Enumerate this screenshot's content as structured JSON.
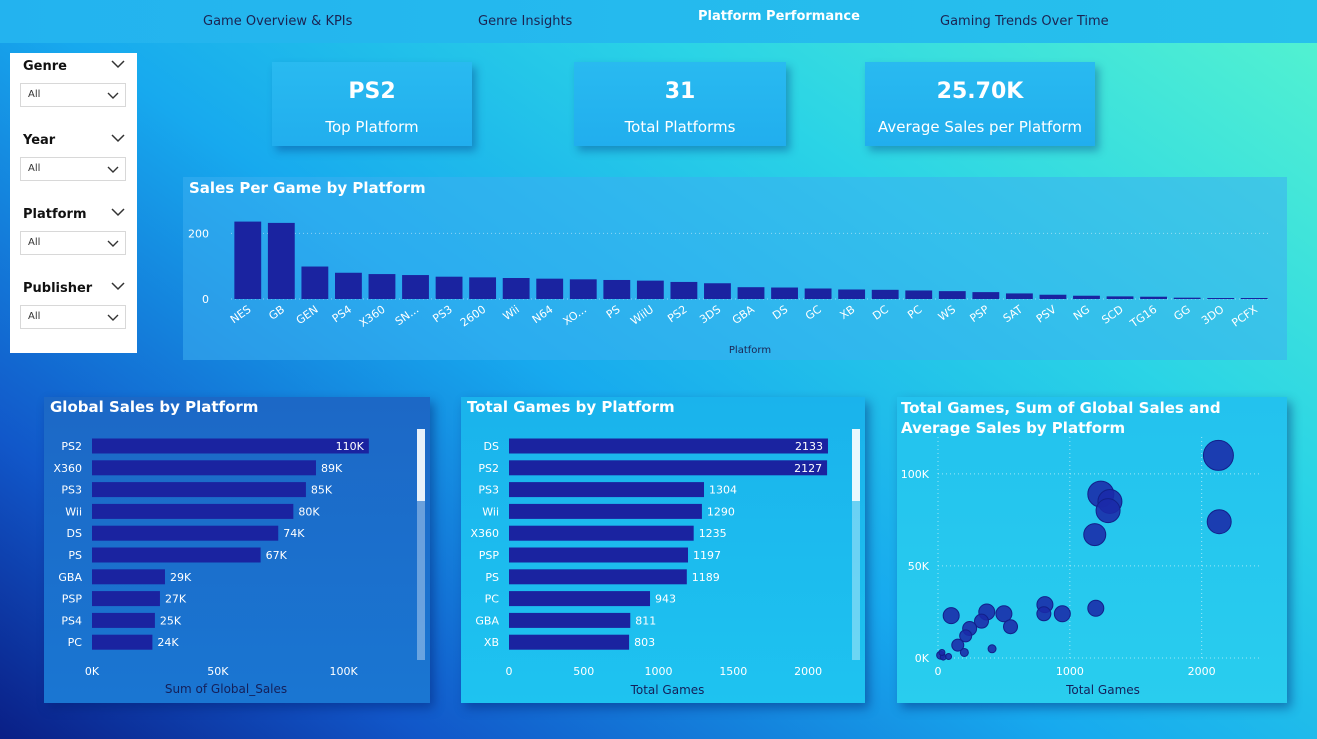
{
  "nav": {
    "tabs": [
      {
        "label": "Game Overview & KPIs"
      },
      {
        "label": "Genre Insights"
      },
      {
        "label": "Platform Performance"
      },
      {
        "label": "Gaming Trends Over Time"
      }
    ],
    "active": "Platform Performance"
  },
  "slicers": [
    {
      "title": "Genre",
      "value": "All"
    },
    {
      "title": "Year",
      "value": "All"
    },
    {
      "title": "Platform",
      "value": "All"
    },
    {
      "title": "Publisher",
      "value": "All"
    }
  ],
  "kpis": [
    {
      "value": "PS2",
      "label": "Top Platform"
    },
    {
      "value": "31",
      "label": "Total Platforms"
    },
    {
      "value": "25.70K",
      "label": "Average Sales per Platform"
    }
  ],
  "colors": {
    "bar": "#1a23a0",
    "bubble": "#1a2aa8"
  },
  "chart_data": [
    {
      "type": "bar",
      "title": "Sales Per Game by Platform",
      "xlabel": "Platform",
      "ylabel": "",
      "categories": [
        "NES",
        "GB",
        "GEN",
        "PS4",
        "X360",
        "SN...",
        "PS3",
        "2600",
        "Wii",
        "N64",
        "XO...",
        "PS",
        "WiiU",
        "PS2",
        "3DS",
        "GBA",
        "DS",
        "GC",
        "XB",
        "DC",
        "PC",
        "WS",
        "PSP",
        "SAT",
        "PSV",
        "NG",
        "SCD",
        "TG16",
        "GG",
        "3DO",
        "PCFX"
      ],
      "values": [
        236,
        232,
        99,
        80,
        76,
        73,
        68,
        66,
        64,
        62,
        60,
        58,
        56,
        52,
        48,
        36,
        35,
        32,
        29,
        28,
        26,
        24,
        21,
        17,
        13,
        10,
        8,
        7,
        4,
        2,
        1
      ],
      "yticks": [
        "0",
        "200"
      ],
      "ylim": [
        0,
        250
      ],
      "grid": true
    },
    {
      "type": "bar",
      "orientation": "horizontal",
      "title": "Global Sales by Platform",
      "xlabel": "Sum of Global_Sales",
      "categories": [
        "PS2",
        "X360",
        "PS3",
        "Wii",
        "DS",
        "PS",
        "GBA",
        "PSP",
        "PS4",
        "PC"
      ],
      "values": [
        110000,
        89000,
        85000,
        80000,
        74000,
        67000,
        29000,
        27000,
        25000,
        24000
      ],
      "labels": [
        "110K",
        "89K",
        "85K",
        "80K",
        "74K",
        "67K",
        "29K",
        "27K",
        "25K",
        "24K"
      ],
      "xticks": [
        "0K",
        "50K",
        "100K"
      ],
      "xlim": [
        0,
        120000
      ]
    },
    {
      "type": "bar",
      "orientation": "horizontal",
      "title": "Total Games by Platform",
      "xlabel": "Total Games",
      "categories": [
        "DS",
        "PS2",
        "PS3",
        "Wii",
        "X360",
        "PSP",
        "PS",
        "PC",
        "GBA",
        "XB"
      ],
      "values": [
        2133,
        2127,
        1304,
        1290,
        1235,
        1197,
        1189,
        943,
        811,
        803
      ],
      "labels": [
        "2133",
        "2127",
        "1304",
        "1290",
        "1235",
        "1197",
        "1189",
        "943",
        "811",
        "803"
      ],
      "xticks": [
        "0",
        "500",
        "1000",
        "1500",
        "2000"
      ],
      "xlim": [
        0,
        2200
      ]
    },
    {
      "type": "scatter",
      "title": "Total Games, Sum of Global Sales and Average Sales by Platform",
      "xlabel": "Total Games",
      "xticks": [
        "0",
        "1000",
        "2000"
      ],
      "yticks": [
        "0K",
        "50K",
        "100K"
      ],
      "xlim": [
        0,
        2450
      ],
      "ylim": [
        0,
        120000
      ],
      "points": [
        {
          "x": 2127,
          "y": 110000,
          "size": 15
        },
        {
          "x": 2133,
          "y": 74000,
          "size": 12
        },
        {
          "x": 1235,
          "y": 89000,
          "size": 13
        },
        {
          "x": 1304,
          "y": 85000,
          "size": 12
        },
        {
          "x": 1290,
          "y": 80000,
          "size": 12
        },
        {
          "x": 1189,
          "y": 67000,
          "size": 11
        },
        {
          "x": 1197,
          "y": 27000,
          "size": 8
        },
        {
          "x": 811,
          "y": 29000,
          "size": 8
        },
        {
          "x": 943,
          "y": 24000,
          "size": 8
        },
        {
          "x": 803,
          "y": 24000,
          "size": 7
        },
        {
          "x": 370,
          "y": 25000,
          "size": 8
        },
        {
          "x": 500,
          "y": 24000,
          "size": 8
        },
        {
          "x": 100,
          "y": 23000,
          "size": 8
        },
        {
          "x": 330,
          "y": 20000,
          "size": 7
        },
        {
          "x": 550,
          "y": 17000,
          "size": 7
        },
        {
          "x": 240,
          "y": 16000,
          "size": 7
        },
        {
          "x": 210,
          "y": 12000,
          "size": 6
        },
        {
          "x": 150,
          "y": 7000,
          "size": 6
        },
        {
          "x": 200,
          "y": 3000,
          "size": 4
        },
        {
          "x": 410,
          "y": 5000,
          "size": 4
        },
        {
          "x": 20,
          "y": 1500,
          "size": 4
        },
        {
          "x": 40,
          "y": 500,
          "size": 3
        },
        {
          "x": 80,
          "y": 800,
          "size": 3
        },
        {
          "x": 30,
          "y": 3000,
          "size": 3
        }
      ]
    }
  ]
}
